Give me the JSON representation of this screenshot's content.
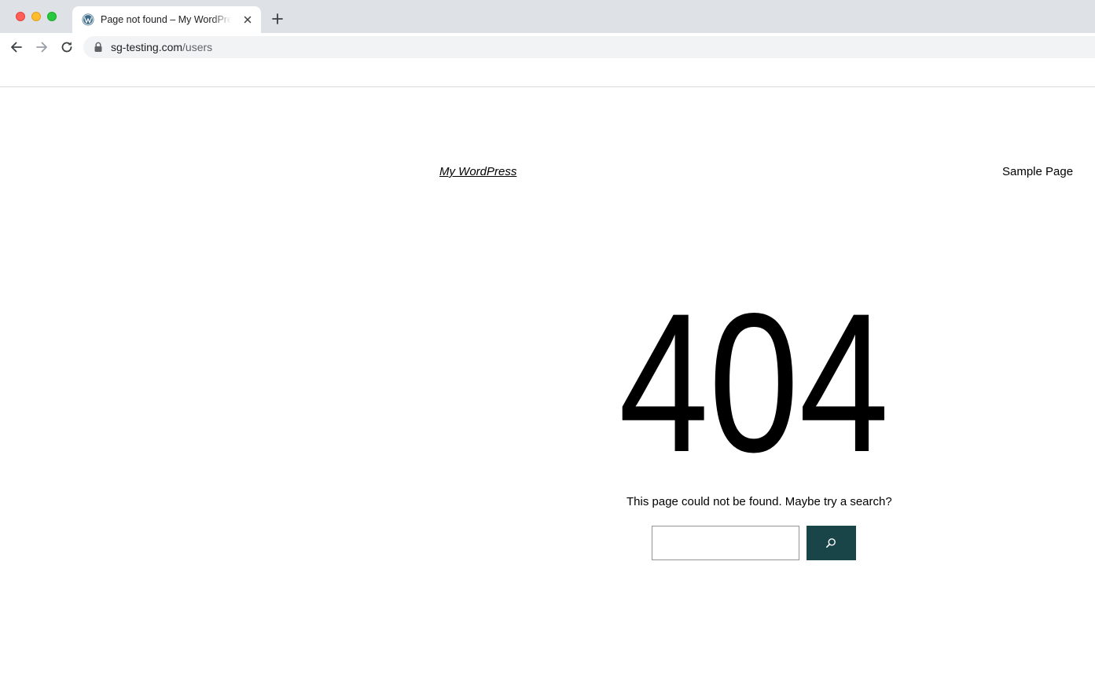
{
  "browser": {
    "tab": {
      "title": "Page not found – My WordPress",
      "favicon": "wordpress-icon"
    },
    "address_bar": {
      "host": "sg-testing.com",
      "path": "/users"
    },
    "icons": {
      "back": "arrow-left-icon",
      "forward": "arrow-right-icon",
      "reload": "reload-icon",
      "lock": "lock-icon",
      "close": "close-icon",
      "new_tab": "plus-icon"
    }
  },
  "site": {
    "title": "My WordPress",
    "nav": {
      "items": [
        "Sample Page"
      ]
    }
  },
  "error": {
    "code": "404",
    "message": "This page could not be found. Maybe try a search?"
  },
  "search": {
    "value": "",
    "placeholder": "",
    "button_icon": "search-icon"
  },
  "colors": {
    "accent": "#1a4548",
    "tab_strip": "#dee1e6",
    "omnibox": "#f1f3f4"
  }
}
